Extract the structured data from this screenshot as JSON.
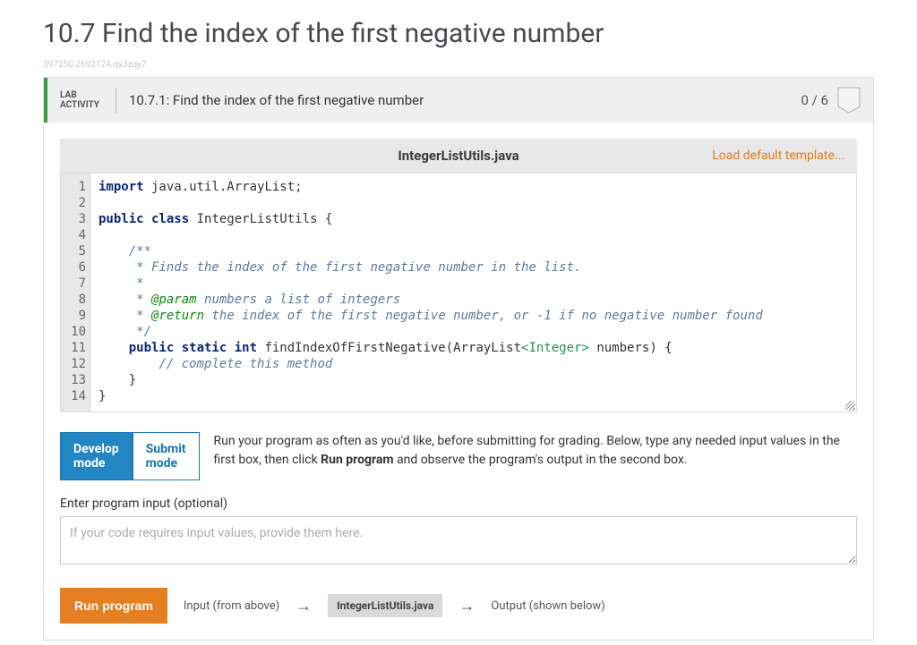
{
  "page_title": "10.7 Find the index of the first negative number",
  "watermark": "397250.2692124.qx3zqy7",
  "lab": {
    "label_top": "LAB",
    "label_bottom": "ACTIVITY",
    "title": "10.7.1: Find the index of the first negative number",
    "score": "0 / 6"
  },
  "file": {
    "name": "IntegerListUtils.java",
    "load_template": "Load default template..."
  },
  "code_lines": [
    [
      {
        "t": "import",
        "c": "kw"
      },
      {
        "t": " java.util.ArrayList;"
      }
    ],
    [],
    [
      {
        "t": "public class",
        "c": "kw"
      },
      {
        "t": " IntegerListUtils {"
      }
    ],
    [],
    [
      {
        "t": "    "
      },
      {
        "t": "/**",
        "c": "com"
      }
    ],
    [
      {
        "t": "    "
      },
      {
        "t": " * Finds the index of the first negative number in the list.",
        "c": "com"
      }
    ],
    [
      {
        "t": "    "
      },
      {
        "t": " *",
        "c": "com"
      }
    ],
    [
      {
        "t": "    "
      },
      {
        "t": " * ",
        "c": "com"
      },
      {
        "t": "@param",
        "c": "ann"
      },
      {
        "t": " numbers a list of integers",
        "c": "com"
      }
    ],
    [
      {
        "t": "    "
      },
      {
        "t": " * ",
        "c": "com"
      },
      {
        "t": "@return",
        "c": "ann"
      },
      {
        "t": " the index of the first negative number, or -1 if no negative number found",
        "c": "com"
      }
    ],
    [
      {
        "t": "    "
      },
      {
        "t": " */",
        "c": "com"
      }
    ],
    [
      {
        "t": "    "
      },
      {
        "t": "public static int",
        "c": "kw"
      },
      {
        "t": " findIndexOfFirstNegative(ArrayList"
      },
      {
        "t": "<Integer>",
        "c": "lit"
      },
      {
        "t": " numbers) {"
      }
    ],
    [
      {
        "t": "        "
      },
      {
        "t": "// complete this method",
        "c": "com"
      }
    ],
    [
      {
        "t": "    }"
      }
    ],
    [
      {
        "t": "}"
      }
    ]
  ],
  "modes": {
    "develop": "Develop mode",
    "submit": "Submit mode",
    "description": "Run your program as often as you'd like, before submitting for grading. Below, type any needed input values in the first box, then click Run program and observe the program's output in the second box."
  },
  "input": {
    "label": "Enter program input (optional)",
    "placeholder": "If your code requires input values, provide them here."
  },
  "run": {
    "button": "Run program",
    "input_label": "Input (from above)",
    "file_chip": "IntegerListUtils.java",
    "output_label": "Output (shown below)"
  },
  "chart_data": null
}
